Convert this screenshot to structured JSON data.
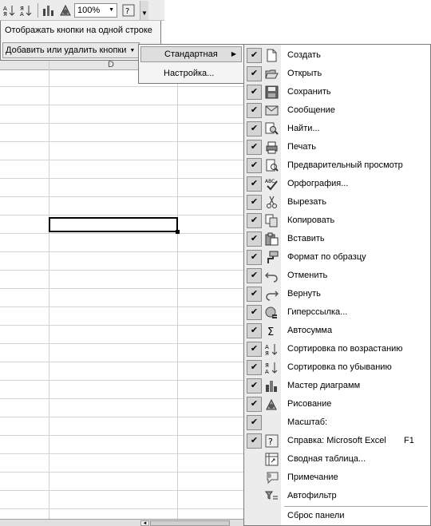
{
  "toolbar": {
    "zoom_value": "100%",
    "icons": [
      "sort-ascending-icon",
      "sort-descending-icon",
      "chart-wizard-icon",
      "drawing-icon",
      "zoom-dropdown-icon",
      "help-icon",
      "toolbar-options-icon"
    ]
  },
  "toolbar_options_menu": {
    "show_one_row": "Отображать кнопки на одной строке",
    "add_remove_buttons": "Добавить или удалить кнопки"
  },
  "toolbars_submenu": {
    "standard": "Стандартная",
    "settings": "Настройка..."
  },
  "sheet": {
    "column_label": "D"
  },
  "commands": [
    {
      "label": "Создать",
      "checked": true,
      "icon": "new-document-icon",
      "shortcut": ""
    },
    {
      "label": "Открыть",
      "checked": true,
      "icon": "open-folder-icon",
      "shortcut": ""
    },
    {
      "label": "Сохранить",
      "checked": true,
      "icon": "save-disk-icon",
      "shortcut": ""
    },
    {
      "label": "Сообщение",
      "checked": true,
      "icon": "email-message-icon",
      "shortcut": ""
    },
    {
      "label": "Найти...",
      "checked": true,
      "icon": "find-icon",
      "shortcut": ""
    },
    {
      "label": "Печать",
      "checked": true,
      "icon": "printer-icon",
      "shortcut": ""
    },
    {
      "label": "Предварительный просмотр",
      "checked": true,
      "icon": "print-preview-icon",
      "shortcut": ""
    },
    {
      "label": "Орфография...",
      "checked": true,
      "icon": "spelling-icon",
      "shortcut": ""
    },
    {
      "label": "Вырезать",
      "checked": true,
      "icon": "scissors-icon",
      "shortcut": ""
    },
    {
      "label": "Копировать",
      "checked": true,
      "icon": "copy-icon",
      "shortcut": ""
    },
    {
      "label": "Вставить",
      "checked": true,
      "icon": "paste-icon",
      "shortcut": ""
    },
    {
      "label": "Формат по образцу",
      "checked": true,
      "icon": "format-painter-icon",
      "shortcut": ""
    },
    {
      "label": "Отменить",
      "checked": true,
      "icon": "undo-icon",
      "shortcut": ""
    },
    {
      "label": "Вернуть",
      "checked": true,
      "icon": "redo-icon",
      "shortcut": ""
    },
    {
      "label": "Гиперссылка...",
      "checked": true,
      "icon": "hyperlink-icon",
      "shortcut": ""
    },
    {
      "label": "Автосумма",
      "checked": true,
      "icon": "autosum-icon",
      "shortcut": ""
    },
    {
      "label": "Сортировка по возрастанию",
      "checked": true,
      "icon": "sort-ascending-icon",
      "shortcut": ""
    },
    {
      "label": "Сортировка по убыванию",
      "checked": true,
      "icon": "sort-descending-icon",
      "shortcut": ""
    },
    {
      "label": "Мастер диаграмм",
      "checked": true,
      "icon": "chart-wizard-icon",
      "shortcut": ""
    },
    {
      "label": "Рисование",
      "checked": true,
      "icon": "drawing-icon",
      "shortcut": ""
    },
    {
      "label": "Масштаб:",
      "checked": true,
      "icon": "",
      "shortcut": ""
    },
    {
      "label": "Справка: Microsoft Excel",
      "checked": true,
      "icon": "help-icon",
      "shortcut": "F1"
    },
    {
      "label": "Сводная таблица...",
      "checked": false,
      "icon": "pivot-table-icon",
      "shortcut": ""
    },
    {
      "label": "Примечание",
      "checked": false,
      "icon": "comment-icon",
      "shortcut": ""
    },
    {
      "label": "Автофильтр",
      "checked": false,
      "icon": "autofilter-icon",
      "shortcut": ""
    }
  ],
  "reset_label": "Сброс панели"
}
